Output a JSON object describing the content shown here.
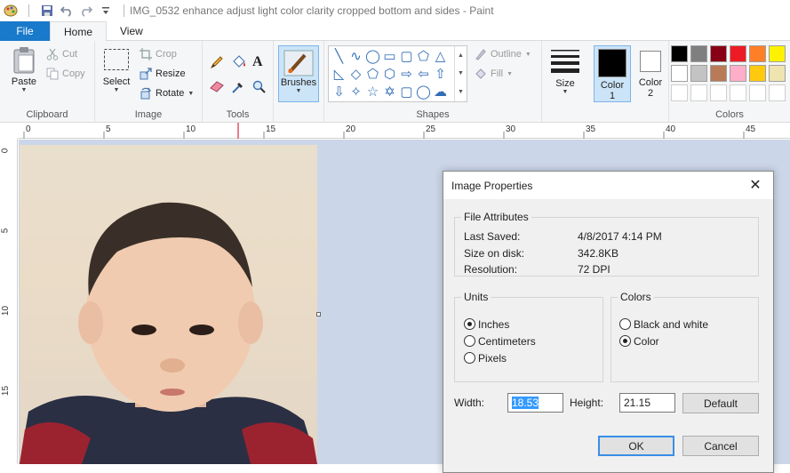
{
  "window": {
    "title": "IMG_0532 enhance adjust light color clarity cropped bottom and sides - Paint"
  },
  "quick_access": {
    "icons": [
      "paint-app-icon",
      "save-icon",
      "undo-icon",
      "redo-icon",
      "customize-icon"
    ]
  },
  "tabs": [
    {
      "label": "File"
    },
    {
      "label": "Home"
    },
    {
      "label": "View"
    }
  ],
  "ribbon": {
    "clipboard": {
      "group": "Clipboard",
      "paste": "Paste",
      "cut": "Cut",
      "copy": "Copy"
    },
    "image": {
      "group": "Image",
      "select": "Select",
      "crop": "Crop",
      "resize": "Resize",
      "rotate": "Rotate"
    },
    "tools": {
      "group": "Tools"
    },
    "brushes": {
      "label": "Brushes"
    },
    "shapes": {
      "group": "Shapes",
      "outline": "Outline",
      "fill": "Fill"
    },
    "size": {
      "label": "Size"
    },
    "color1": {
      "label_line1": "Color",
      "label_line2": "1"
    },
    "color2": {
      "label_line1": "Color",
      "label_line2": "2"
    },
    "colors": {
      "group": "Colors"
    }
  },
  "palette": {
    "row1": [
      "#000000",
      "#7f7f7f",
      "#880015",
      "#ed1c24",
      "#ff7f27",
      "#fff200"
    ],
    "row2": [
      "#ffffff",
      "#c3c3c3",
      "#b97a57",
      "#ffaec9",
      "#ffc90e",
      "#efe4b0"
    ],
    "row3": [
      "#ffffff",
      "#ffffff",
      "#ffffff",
      "#ffffff",
      "#ffffff",
      "#ffffff"
    ],
    "color1": "#000000",
    "color2": "#ffffff"
  },
  "ruler": {
    "top": [
      "0",
      "5",
      "10",
      "15",
      "20",
      "25",
      "30",
      "35",
      "40",
      "45"
    ],
    "left": [
      "0",
      "5",
      "10",
      "15"
    ]
  },
  "dialog": {
    "title": "Image Properties",
    "file_attributes": {
      "legend": "File Attributes",
      "last_saved_label": "Last Saved:",
      "last_saved_value": "4/8/2017 4:14 PM",
      "size_label": "Size on disk:",
      "size_value": "342.8KB",
      "resolution_label": "Resolution:",
      "resolution_value": "72 DPI"
    },
    "units": {
      "legend": "Units",
      "options": [
        "Inches",
        "Centimeters",
        "Pixels"
      ],
      "selected": "Inches"
    },
    "colors": {
      "legend": "Colors",
      "options": [
        "Black and white",
        "Color"
      ],
      "selected": "Color"
    },
    "width_label": "Width:",
    "width_value": "18.53",
    "height_label": "Height:",
    "height_value": "21.15",
    "default_button": "Default",
    "ok_button": "OK",
    "cancel_button": "Cancel"
  }
}
